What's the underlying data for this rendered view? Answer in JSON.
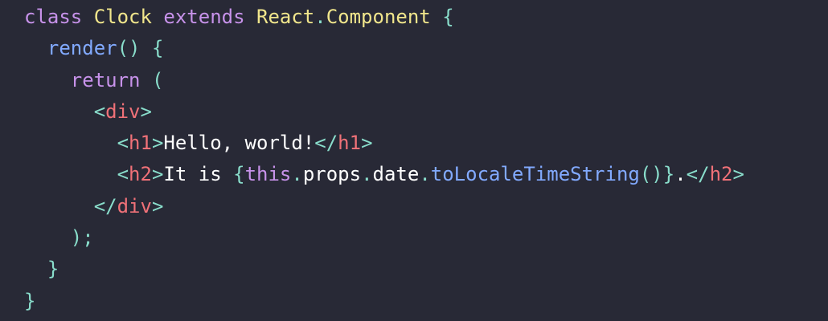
{
  "colors": {
    "background": "#282936",
    "default": "#f8f8f2",
    "keyword": "#c792ea",
    "class_name": "#f1e68c",
    "punctuation": "#89ddcb",
    "function": "#82aaff",
    "tag": "#f07178",
    "text": "#ffffff"
  },
  "code": {
    "lines": [
      [
        {
          "t": "class ",
          "c": "keyword"
        },
        {
          "t": "Clock ",
          "c": "class_name"
        },
        {
          "t": "extends ",
          "c": "keyword"
        },
        {
          "t": "React",
          "c": "class_name"
        },
        {
          "t": ".",
          "c": "punctuation"
        },
        {
          "t": "Component ",
          "c": "class_name"
        },
        {
          "t": "{",
          "c": "punctuation"
        }
      ],
      [
        {
          "t": "  ",
          "c": "default"
        },
        {
          "t": "render",
          "c": "function"
        },
        {
          "t": "() {",
          "c": "punctuation"
        }
      ],
      [
        {
          "t": "    ",
          "c": "default"
        },
        {
          "t": "return ",
          "c": "keyword"
        },
        {
          "t": "(",
          "c": "punctuation"
        }
      ],
      [
        {
          "t": "      ",
          "c": "default"
        },
        {
          "t": "<",
          "c": "punctuation"
        },
        {
          "t": "div",
          "c": "tag"
        },
        {
          "t": ">",
          "c": "punctuation"
        }
      ],
      [
        {
          "t": "        ",
          "c": "default"
        },
        {
          "t": "<",
          "c": "punctuation"
        },
        {
          "t": "h1",
          "c": "tag"
        },
        {
          "t": ">",
          "c": "punctuation"
        },
        {
          "t": "Hello, world!",
          "c": "text"
        },
        {
          "t": "</",
          "c": "punctuation"
        },
        {
          "t": "h1",
          "c": "tag"
        },
        {
          "t": ">",
          "c": "punctuation"
        }
      ],
      [
        {
          "t": "        ",
          "c": "default"
        },
        {
          "t": "<",
          "c": "punctuation"
        },
        {
          "t": "h2",
          "c": "tag"
        },
        {
          "t": ">",
          "c": "punctuation"
        },
        {
          "t": "It is ",
          "c": "text"
        },
        {
          "t": "{",
          "c": "punctuation"
        },
        {
          "t": "this",
          "c": "keyword"
        },
        {
          "t": ".",
          "c": "punctuation"
        },
        {
          "t": "props",
          "c": "text"
        },
        {
          "t": ".",
          "c": "punctuation"
        },
        {
          "t": "date",
          "c": "text"
        },
        {
          "t": ".",
          "c": "punctuation"
        },
        {
          "t": "toLocaleTimeString",
          "c": "function"
        },
        {
          "t": "()}",
          "c": "punctuation"
        },
        {
          "t": ".",
          "c": "text"
        },
        {
          "t": "</",
          "c": "punctuation"
        },
        {
          "t": "h2",
          "c": "tag"
        },
        {
          "t": ">",
          "c": "punctuation"
        }
      ],
      [
        {
          "t": "      ",
          "c": "default"
        },
        {
          "t": "</",
          "c": "punctuation"
        },
        {
          "t": "div",
          "c": "tag"
        },
        {
          "t": ">",
          "c": "punctuation"
        }
      ],
      [
        {
          "t": "    ",
          "c": "default"
        },
        {
          "t": ");",
          "c": "punctuation"
        }
      ],
      [
        {
          "t": "  ",
          "c": "default"
        },
        {
          "t": "}",
          "c": "punctuation"
        }
      ],
      [
        {
          "t": "}",
          "c": "punctuation"
        }
      ]
    ]
  }
}
